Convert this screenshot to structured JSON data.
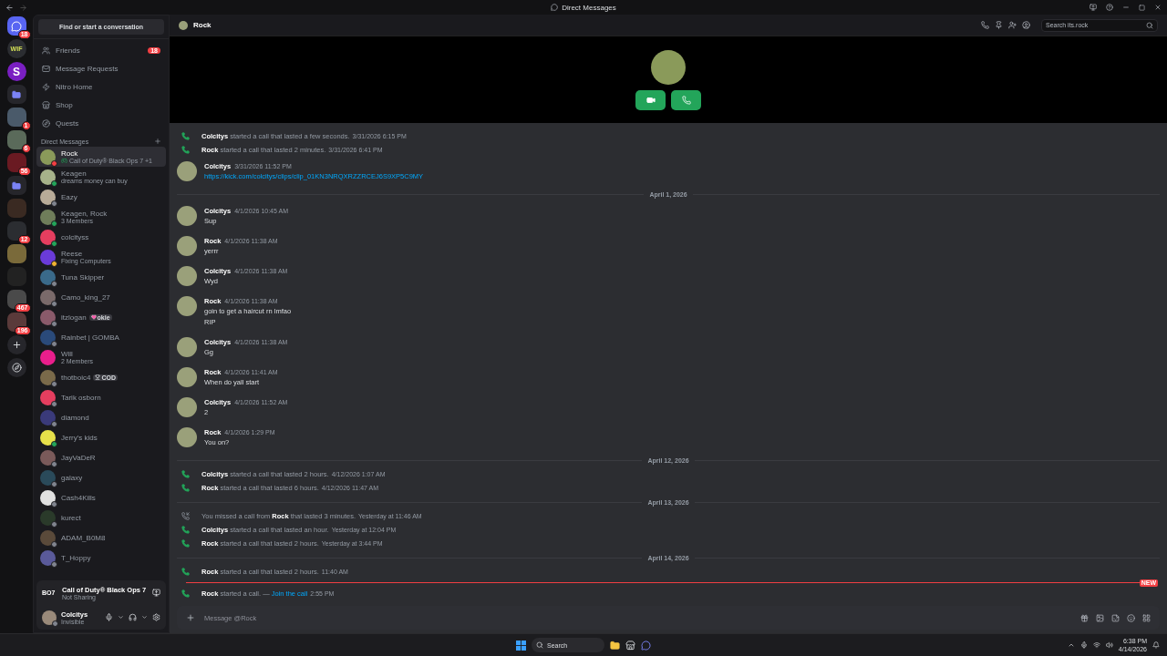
{
  "window": {
    "title": "Direct Messages"
  },
  "servers": [
    {
      "kind": "home",
      "badge": "18"
    },
    {
      "kind": "server",
      "label": "WIF",
      "color": "#2b2d31"
    },
    {
      "kind": "server",
      "label": "S",
      "color": "#7a1fc2"
    },
    {
      "kind": "folder"
    },
    {
      "kind": "server",
      "badge": "1",
      "color": "#4a5a6a"
    },
    {
      "kind": "server",
      "badge": "6",
      "color": "#5a6a5a"
    },
    {
      "kind": "server",
      "badge": "56",
      "color": "#6a1a22"
    },
    {
      "kind": "folder"
    },
    {
      "kind": "server",
      "color": "#3a2a22"
    },
    {
      "kind": "server",
      "badge": "12",
      "color": "#2b2d31"
    },
    {
      "kind": "server",
      "color": "#7a6a3a"
    },
    {
      "kind": "server",
      "color": "#222222"
    },
    {
      "kind": "server",
      "badge": "467",
      "color": "#4a4a4a"
    },
    {
      "kind": "server",
      "badge": "196",
      "color": "#5a3a3a"
    },
    {
      "kind": "add"
    },
    {
      "kind": "discover"
    }
  ],
  "search": {
    "placeholder": "Find or start a conversation"
  },
  "nav": [
    {
      "kind": "friends",
      "label": "Friends",
      "badge": "18"
    },
    {
      "kind": "requests",
      "label": "Message Requests"
    },
    {
      "kind": "nitro",
      "label": "Nitro Home"
    },
    {
      "kind": "shop",
      "label": "Shop"
    },
    {
      "kind": "quests",
      "label": "Quests"
    }
  ],
  "dm_header": "Direct Messages",
  "dms": [
    {
      "name": "Rock",
      "subtitle": "Call of Duty® Black Ops 7 +1",
      "color": "#f23f43",
      "selected": true,
      "game": true
    },
    {
      "name": "Keagen",
      "subtitle": "dreams money can buy",
      "color": "#23a55a",
      "selected": false
    },
    {
      "name": "Eazy",
      "color": "#80848e",
      "selected": false
    },
    {
      "name": "Keagen, Rock",
      "subtitle": "3 Members",
      "color": "#23a55a",
      "selected": false
    },
    {
      "name": "colcityss",
      "color": "#23a55a",
      "selected": false
    },
    {
      "name": "Reese",
      "subtitle": "Fixing Computers",
      "color": "#f0b232",
      "selected": false
    },
    {
      "name": "Tuna Skipper",
      "color": "#80848e",
      "selected": false
    },
    {
      "name": "Camo_king_27",
      "color": "#80848e",
      "selected": false
    },
    {
      "name": "itzlogan",
      "tag": "okie",
      "color": "#80848e",
      "selected": false
    },
    {
      "name": "Rainbet | GOMBA",
      "color": "#80848e",
      "selected": false
    },
    {
      "name": "Will",
      "subtitle": "2 Members",
      "selected": false
    },
    {
      "name": "thotboic4",
      "tag": "COD",
      "color": "#80848e",
      "selected": false
    },
    {
      "name": "Tarik osborn",
      "color": "#80848e",
      "selected": false
    },
    {
      "name": "diamond",
      "color": "#80848e",
      "selected": false
    },
    {
      "name": "Jerry's kids",
      "color": "#23a55a",
      "selected": false
    },
    {
      "name": "JayVaDeR",
      "color": "#80848e",
      "selected": false
    },
    {
      "name": "galaxy",
      "color": "#80848e",
      "selected": false
    },
    {
      "name": "Cash4Kills",
      "color": "#80848e",
      "selected": false
    },
    {
      "name": "kurect",
      "color": "#80848e",
      "selected": false
    },
    {
      "name": "ADAM_B0M8",
      "color": "#80848e",
      "selected": false
    },
    {
      "name": "T_Hoppy",
      "color": "#80848e",
      "selected": false
    }
  ],
  "activity": {
    "logo": "BO7",
    "title": "Call of Duty® Black Ops 7",
    "subtitle": "Not Sharing"
  },
  "user": {
    "name": "Colcitys",
    "status_text": "Invisible",
    "color": "#80848e"
  },
  "channel": {
    "name": "Rock",
    "search_placeholder": "Search its.rock"
  },
  "messages": [
    {
      "kind": "call",
      "missed": false,
      "author": "Colcitys",
      "text": "started a call that lasted a few seconds.",
      "time": "3/31/2026 6:15 PM"
    },
    {
      "kind": "call",
      "missed": false,
      "author": "Rock",
      "text": "started a call that lasted 2 minutes.",
      "time": "3/31/2026 6:41 PM"
    },
    {
      "kind": "message",
      "author": "Colcitys",
      "time": "3/31/2026 11:52 PM",
      "link": true,
      "lines": [
        "https://kick.com/colcitys/clips/clip_01KN3NRQXRZZRCEJ6S9XP5C9MY"
      ]
    },
    {
      "kind": "divider",
      "label": "April 1, 2026"
    },
    {
      "kind": "message",
      "author": "Colcitys",
      "time": "4/1/2026 10:45 AM",
      "link": false,
      "lines": [
        "Sup"
      ]
    },
    {
      "kind": "message",
      "author": "Rock",
      "time": "4/1/2026 11:38 AM",
      "link": false,
      "lines": [
        "yerrr"
      ]
    },
    {
      "kind": "message",
      "author": "Colcitys",
      "time": "4/1/2026 11:38 AM",
      "link": false,
      "lines": [
        "Wyd"
      ]
    },
    {
      "kind": "message",
      "author": "Rock",
      "time": "4/1/2026 11:38 AM",
      "link": false,
      "lines": [
        "goin to get a haircut rn lmfao",
        "RIP"
      ]
    },
    {
      "kind": "message",
      "author": "Colcitys",
      "time": "4/1/2026 11:38 AM",
      "link": false,
      "lines": [
        "Gg"
      ]
    },
    {
      "kind": "message",
      "author": "Rock",
      "time": "4/1/2026 11:41 AM",
      "link": false,
      "lines": [
        "When do yall start"
      ]
    },
    {
      "kind": "message",
      "author": "Colcitys",
      "time": "4/1/2026 11:52 AM",
      "link": false,
      "lines": [
        "2"
      ]
    },
    {
      "kind": "message",
      "author": "Rock",
      "time": "4/1/2026 1:29 PM",
      "link": false,
      "lines": [
        "You on?"
      ]
    },
    {
      "kind": "divider",
      "label": "April 12, 2026"
    },
    {
      "kind": "call",
      "missed": false,
      "author": "Colcitys",
      "text": "started a call that lasted 2 hours.",
      "time": "4/12/2026 1:07 AM"
    },
    {
      "kind": "call",
      "missed": false,
      "author": "Rock",
      "text": "started a call that lasted 6 hours.",
      "time": "4/12/2026 11:47 AM"
    },
    {
      "kind": "divider",
      "label": "April 13, 2026"
    },
    {
      "kind": "call",
      "missed": true,
      "prefix": "You missed a call from",
      "author": "Rock",
      "text": "that lasted 3 minutes.",
      "time": "Yesterday at 11:46 AM"
    },
    {
      "kind": "call",
      "missed": false,
      "author": "Colcitys",
      "text": "started a call that lasted an hour.",
      "time": "Yesterday at 12:04 PM"
    },
    {
      "kind": "call",
      "missed": false,
      "author": "Rock",
      "text": "started a call that lasted 2 hours.",
      "time": "Yesterday at 3:44 PM"
    },
    {
      "kind": "divider",
      "label": "April 14, 2026"
    },
    {
      "kind": "call",
      "missed": false,
      "author": "Rock",
      "text": "started a call that lasted 2 hours.",
      "time": "11:40 AM"
    },
    {
      "kind": "new",
      "label": "NEW"
    },
    {
      "kind": "call",
      "missed": false,
      "author": "Rock",
      "text": "started a call. —",
      "link": "Join the call",
      "time": "2:55 PM"
    }
  ],
  "composer": {
    "placeholder": "Message @Rock"
  },
  "taskbar": {
    "search": "Search",
    "time": "6:38 PM",
    "date": "4/14/2026"
  }
}
